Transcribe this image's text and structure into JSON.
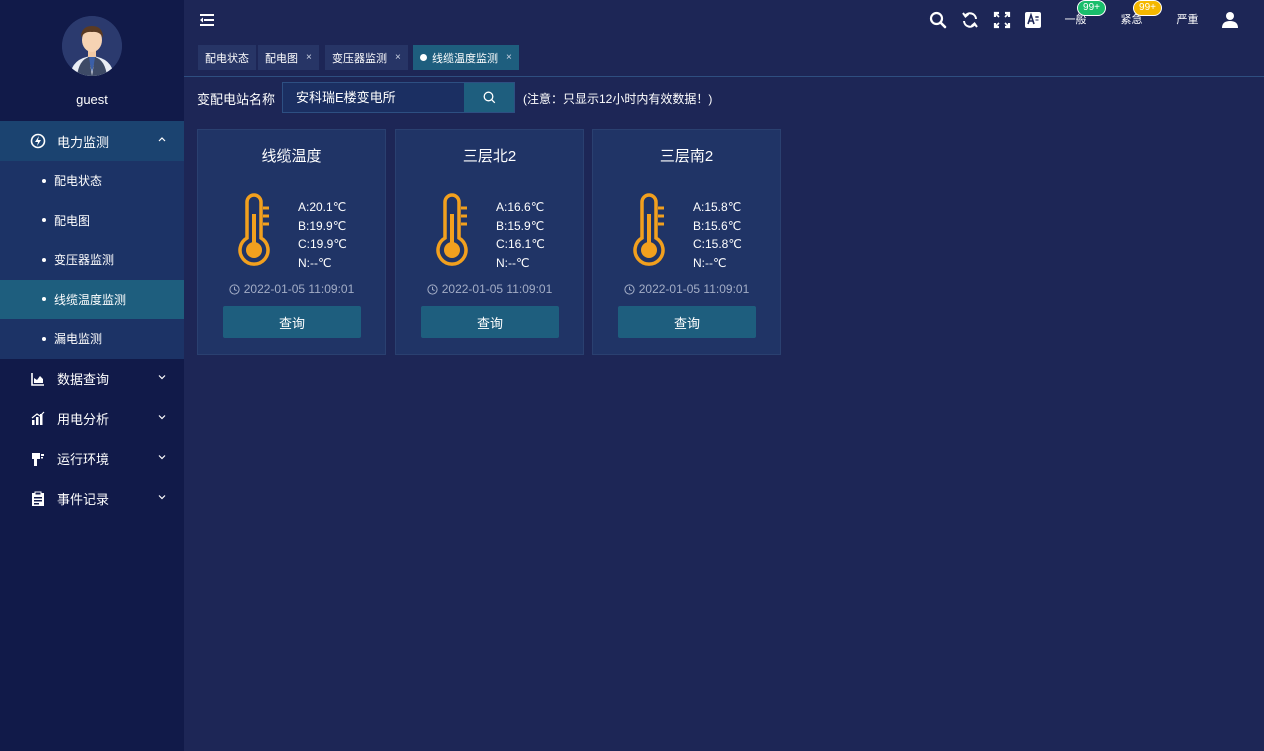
{
  "user": {
    "name": "guest"
  },
  "sidebar": {
    "groups": [
      {
        "label": "电力监测",
        "icon": "power-monitor-icon",
        "open": true,
        "items": [
          {
            "label": "配电状态"
          },
          {
            "label": "配电图"
          },
          {
            "label": "变压器监测"
          },
          {
            "label": "线缆温度监测",
            "active": true
          },
          {
            "label": "漏电监测"
          }
        ]
      },
      {
        "label": "数据查询",
        "icon": "data-query-icon"
      },
      {
        "label": "用电分析",
        "icon": "bar-chart-icon"
      },
      {
        "label": "运行环境",
        "icon": "environment-icon"
      },
      {
        "label": "事件记录",
        "icon": "event-record-icon"
      }
    ]
  },
  "alarms": [
    {
      "label": "一般",
      "count": "99+",
      "color": "#19be6b"
    },
    {
      "label": "紧急",
      "count": "99+",
      "color": "#f5b800"
    },
    {
      "label": "严重",
      "color": "#ed4050"
    }
  ],
  "tabs": [
    {
      "label": "配电状态",
      "closable": false
    },
    {
      "label": "配电图",
      "closable": true,
      "close": "×"
    },
    {
      "label": "变压器监测",
      "closable": true,
      "close": "×"
    },
    {
      "label": "线缆温度监测",
      "closable": true,
      "close": "×",
      "active": true
    }
  ],
  "search": {
    "label": "变配电站名称",
    "value": "安科瑞E楼变电所",
    "note": "(注意：只显示12小时内有效数据！)"
  },
  "cards": [
    {
      "title": "线缆温度",
      "a": "A:20.1℃",
      "b": "B:19.9℃",
      "c": "C:19.9℃",
      "n": "N:--℃",
      "time": "2022-01-05 11:09:01",
      "button": "查询"
    },
    {
      "title": "三层北2",
      "a": "A:16.6℃",
      "b": "B:15.9℃",
      "c": "C:16.1℃",
      "n": "N:--℃",
      "time": "2022-01-05 11:09:01",
      "button": "查询"
    },
    {
      "title": "三层南2",
      "a": "A:15.8℃",
      "b": "B:15.6℃",
      "c": "C:15.8℃",
      "n": "N:--℃",
      "time": "2022-01-05 11:09:01",
      "button": "查询"
    }
  ],
  "colors": {
    "sidebar": "#111a49",
    "main": "#1d2656",
    "accent": "#1e5e7e",
    "thermometer": "#f2a01e"
  }
}
